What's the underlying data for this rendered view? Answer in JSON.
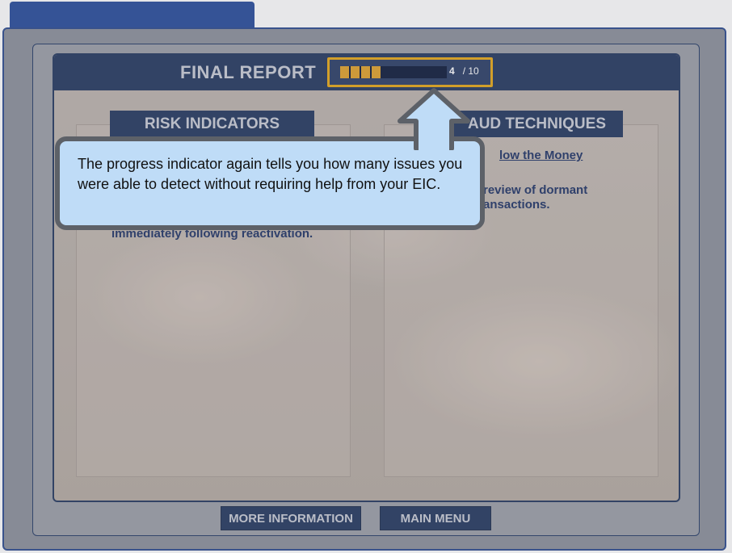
{
  "report": {
    "title": "FINAL REPORT",
    "progress": {
      "completed": 4,
      "total_label": "/ 10",
      "value": 0.4
    }
  },
  "columns": {
    "left": {
      "heading": "RISK INDICATORS",
      "partial_text": "immediately following reactivation."
    },
    "right": {
      "heading": "AUD TECHNIQUES",
      "link": "low the Money",
      "partial_text": "review of dormant ansactions."
    }
  },
  "buttons": {
    "more_info": "MORE INFORMATION",
    "main_menu": "MAIN MENU"
  },
  "callout": {
    "text": "The progress indicator again tells you how many issues you were able to detect without requiring help from your EIC."
  },
  "colors": {
    "header": "#23385e",
    "accent": "#e6a817",
    "callout_bg": "#bfdcf7"
  }
}
